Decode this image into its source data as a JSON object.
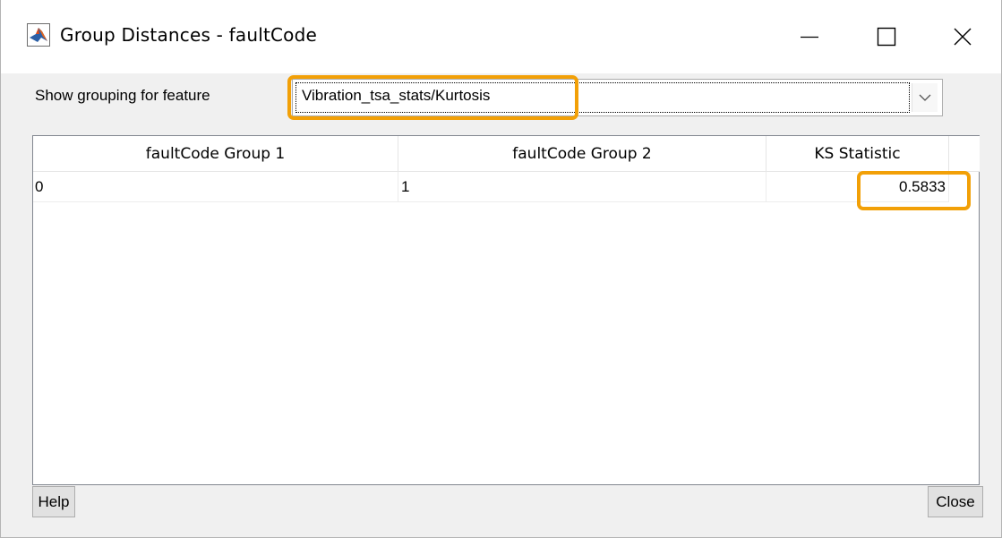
{
  "window": {
    "title": "Group Distances - faultCode",
    "app_icon": "matlab-logo-icon",
    "controls": [
      "minimize-icon",
      "maximize-icon",
      "close-icon"
    ]
  },
  "feature_selector": {
    "label": "Show grouping for feature",
    "selected_value": "Vibration_tsa_stats/Kurtosis",
    "arrow_icon": "chevron-down-icon"
  },
  "table": {
    "columns": [
      "faultCode Group 1",
      "faultCode Group 2",
      "KS Statistic"
    ],
    "rows": [
      [
        "0",
        "1",
        "0.5833"
      ]
    ]
  },
  "buttons": {
    "help_label": "Help",
    "close_label": "Close"
  },
  "colors": {
    "highlight": "#f2a007",
    "window_background": "#f0f0f0",
    "title_bar": "#ffffff"
  }
}
